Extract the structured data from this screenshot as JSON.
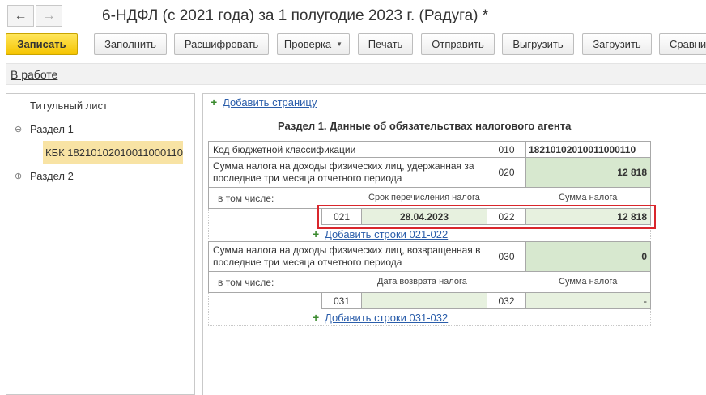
{
  "header": {
    "back_icon": "arrow-left-icon",
    "forward_icon": "arrow-right-icon",
    "title": "6-НДФЛ (с 2021 года) за 1 полугодие 2023 г. (Радуга) *"
  },
  "toolbar": {
    "save": "Записать",
    "fill": "Заполнить",
    "decode": "Расшифровать",
    "check": "Проверка",
    "print": "Печать",
    "send": "Отправить",
    "export": "Выгрузить",
    "import": "Загрузить",
    "compare": "Сравни"
  },
  "status": {
    "link": "В работе"
  },
  "tree": {
    "title_page": "Титульный лист",
    "section1": "Раздел 1",
    "kbk_item": "КБК 18210102010011000110",
    "section2": "Раздел 2"
  },
  "form": {
    "add_page": "Добавить страницу",
    "heading": "Раздел 1. Данные об обязательствах налогового агента",
    "kbk_label": "Код бюджетной классификации",
    "kbk_code": "010",
    "kbk_value": "18210102010011000110",
    "withheld_label": "Сумма налога на доходы физических лиц, удержанная за последние три месяца отчетного периода",
    "withheld_code": "020",
    "withheld_value": "12 818",
    "incl_label_1": "в том числе:",
    "transfer_date_header": "Срок перечисления налога",
    "tax_sum_header_1": "Сумма налога",
    "row021_code": "021",
    "row021_value": "28.04.2023",
    "row022_code": "022",
    "row022_value": "12 818",
    "add_rows_021": "Добавить строки 021-022",
    "returned_label": "Сумма налога на доходы физических лиц, возвращенная в последние три месяца отчетного периода",
    "returned_code": "030",
    "returned_value": "0",
    "incl_label_2": "в том числе:",
    "return_date_header": "Дата возврата налога",
    "tax_sum_header_2": "Сумма налога",
    "row031_code": "031",
    "row031_value": "",
    "row032_code": "032",
    "row032_value": "-",
    "add_rows_031": "Добавить строки 031-032"
  }
}
